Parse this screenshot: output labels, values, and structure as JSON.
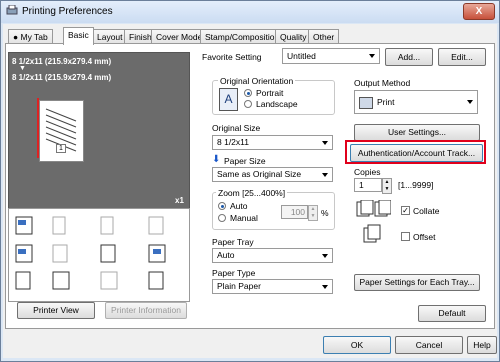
{
  "window": {
    "title": "Printing Preferences",
    "close_label": "X"
  },
  "tabs": [
    "My Tab",
    "Basic",
    "Layout",
    "Finish",
    "Cover Mode",
    "Stamp/Composition",
    "Quality",
    "Other"
  ],
  "preview": {
    "line1": "8 1/2x11 (215.9x279.4 mm)",
    "line2": "8 1/2x11 (215.9x279.4 mm)",
    "arrow": "▼",
    "page_number": "1",
    "copies_badge": "x1"
  },
  "left_buttons": {
    "printer_view": "Printer View",
    "printer_information": "Printer Information"
  },
  "favorite": {
    "label": "Favorite Setting",
    "value": "Untitled",
    "add": "Add...",
    "edit": "Edit..."
  },
  "original_orientation": {
    "label": "Original Orientation",
    "portrait": "Portrait",
    "landscape": "Landscape"
  },
  "original_size": {
    "label": "Original Size",
    "value": "8 1/2x11"
  },
  "paper_size": {
    "label": "Paper Size",
    "value": "Same as Original Size"
  },
  "zoom": {
    "label": "Zoom [25...400%]",
    "auto": "Auto",
    "manual": "Manual",
    "value": "100",
    "unit": "%"
  },
  "paper_tray": {
    "label": "Paper Tray",
    "value": "Auto"
  },
  "paper_type": {
    "label": "Paper Type",
    "value": "Plain Paper"
  },
  "output_method": {
    "label": "Output Method",
    "value": "Print"
  },
  "user_settings": "User Settings...",
  "auth_button": "Authentication/Account Track...",
  "copies": {
    "label": "Copies",
    "value": "1",
    "range": "[1...9999]"
  },
  "collate": "Collate",
  "offset": "Offset",
  "paper_settings_button": "Paper Settings for Each Tray...",
  "default_button": "Default",
  "footer": {
    "ok": "OK",
    "cancel": "Cancel",
    "help": "Help"
  }
}
